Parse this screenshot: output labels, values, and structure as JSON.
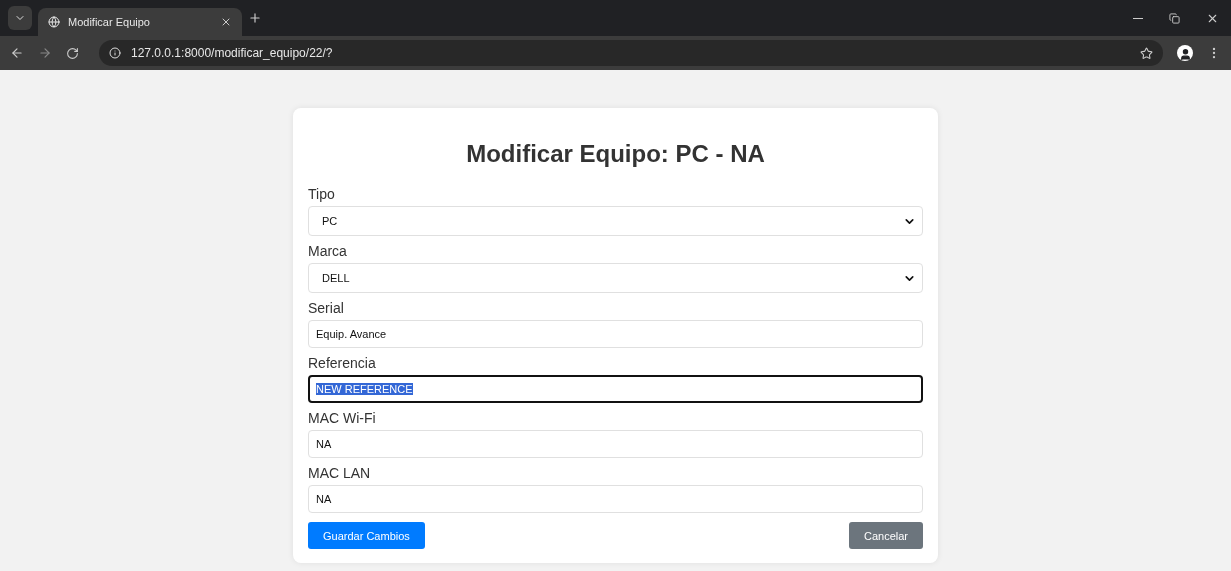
{
  "browser": {
    "tab": {
      "title": "Modificar Equipo"
    },
    "url": "127.0.0.1:8000/modificar_equipo/22/?"
  },
  "form": {
    "title": "Modificar Equipo: PC - NA",
    "fields": [
      {
        "kind": "select",
        "label": "Tipo",
        "value": "PC",
        "focused": false
      },
      {
        "kind": "select",
        "label": "Marca",
        "value": "DELL",
        "focused": false
      },
      {
        "kind": "text",
        "label": "Serial",
        "value": "Equip. Avance",
        "focused": false
      },
      {
        "kind": "text",
        "label": "Referencia",
        "value": "NEW REFERENCE",
        "focused": true
      },
      {
        "kind": "text",
        "label": "MAC Wi-Fi",
        "value": "NA",
        "focused": false
      },
      {
        "kind": "text",
        "label": "MAC LAN",
        "value": "NA",
        "focused": false
      }
    ],
    "buttons": [
      {
        "kind": "primary",
        "label": "Guardar Cambios"
      },
      {
        "kind": "secondary",
        "label": "Cancelar"
      }
    ]
  }
}
